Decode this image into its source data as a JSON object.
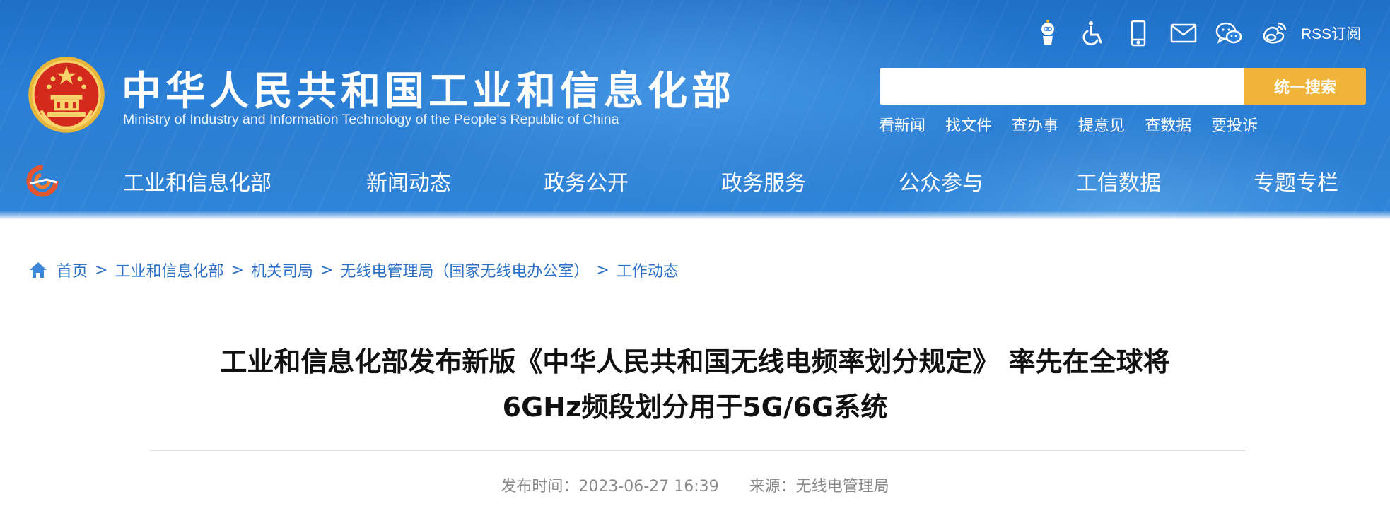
{
  "header": {
    "title_cn": "中华人民共和国工业和信息化部",
    "title_en": "Ministry of Industry and Information Technology of the People's Republic of China",
    "emblem_icon": "national-emblem-icon",
    "top_icons": [
      {
        "name": "robot-assistant-icon"
      },
      {
        "name": "accessibility-icon"
      },
      {
        "name": "mobile-icon"
      },
      {
        "name": "mail-icon"
      },
      {
        "name": "wechat-icon"
      },
      {
        "name": "weibo-icon"
      }
    ],
    "rss_label": "RSS订阅",
    "search": {
      "placeholder": "",
      "value": "",
      "button_label": "统一搜索"
    },
    "quick_links": [
      "看新闻",
      "找文件",
      "查办事",
      "提意见",
      "查数据",
      "要投诉"
    ],
    "colors": {
      "header_blue": "#2a80d6",
      "search_button": "#f1b43a",
      "link_blue": "#2b70c5"
    }
  },
  "nav": {
    "logo_icon": "miit-logo-icon",
    "items": [
      "工业和信息化部",
      "新闻动态",
      "政务公开",
      "政务服务",
      "公众参与",
      "工信数据",
      "专题专栏"
    ]
  },
  "breadcrumb": {
    "home_icon": "home-icon",
    "items": [
      "首页",
      "工业和信息化部",
      "机关司局",
      "无线电管理局（国家无线电办公室）",
      "工作动态"
    ],
    "separator": ">"
  },
  "article": {
    "title_line1": "工业和信息化部发布新版《中华人民共和国无线电频率划分规定》 率先在全球将",
    "title_line2": "6GHz频段划分用于5G/6G系统",
    "publish_time_label": "发布时间：",
    "publish_time": "2023-06-27 16:39",
    "source_label": "来源：",
    "source": "无线电管理局"
  }
}
